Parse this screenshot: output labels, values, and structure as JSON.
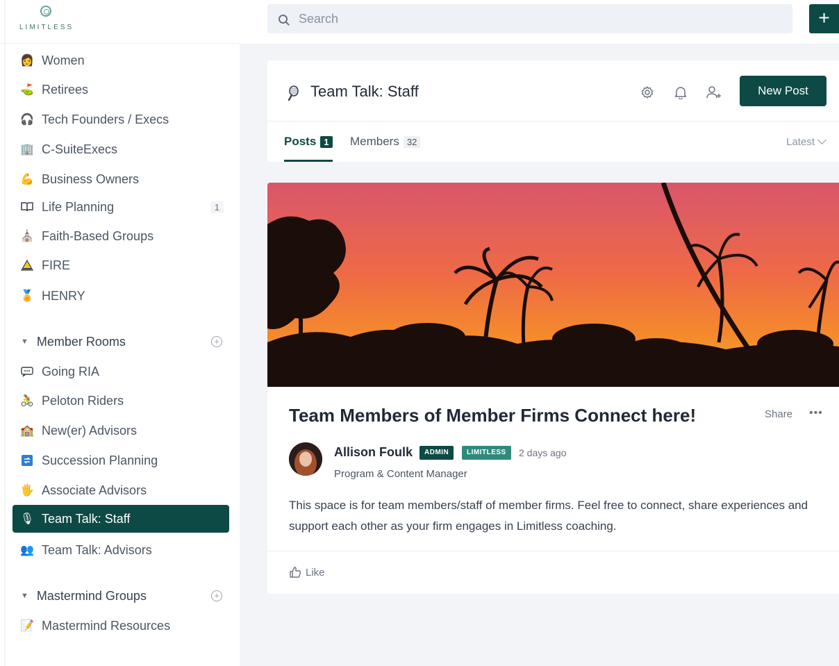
{
  "brand": {
    "name": "LIMITLESS",
    "accent": "#0d4a45"
  },
  "search": {
    "placeholder": "Search"
  },
  "topbar": {
    "add_label": "+"
  },
  "sidebar": {
    "items": [
      {
        "label": "Women",
        "icon": "woman-face-icon",
        "glyph": "👩"
      },
      {
        "label": "Retirees",
        "icon": "golf-icon",
        "glyph": "⛳"
      },
      {
        "label": "Tech Founders / Execs",
        "icon": "headphones-icon",
        "glyph": "🎧"
      },
      {
        "label": "C-SuiteExecs",
        "icon": "office-icon",
        "glyph": "🏢"
      },
      {
        "label": "Business Owners",
        "icon": "flexed-arm-icon",
        "glyph": "💪"
      },
      {
        "label": "Life Planning",
        "icon": "book-icon",
        "glyph": "📖",
        "count": "1"
      },
      {
        "label": "Faith-Based Groups",
        "icon": "church-icon",
        "glyph": "⛪"
      },
      {
        "label": "FIRE",
        "icon": "warning-triangle-icon",
        "glyph": "⚠"
      },
      {
        "label": "HENRY",
        "icon": "badge-icon",
        "glyph": "🏅"
      }
    ],
    "member_rooms": {
      "title": "Member Rooms",
      "items": [
        {
          "label": "Going RIA",
          "icon": "chat-bubble-icon",
          "glyph": "💬"
        },
        {
          "label": "Peloton Riders",
          "icon": "cyclist-icon",
          "glyph": "🚴"
        },
        {
          "label": "New(er) Advisors",
          "icon": "school-icon",
          "glyph": "🏫"
        },
        {
          "label": "Succession Planning",
          "icon": "arrows-cycle-icon",
          "glyph": "🔄"
        },
        {
          "label": "Associate Advisors",
          "icon": "hand-icon",
          "glyph": "🖐"
        },
        {
          "label": "Team Talk: Staff",
          "icon": "microphone-icon",
          "glyph": "🎙",
          "active": true
        },
        {
          "label": "Team Talk: Advisors",
          "icon": "people-icon",
          "glyph": "👥"
        }
      ]
    },
    "mastermind": {
      "title": "Mastermind Groups",
      "items": [
        {
          "label": "Mastermind Resources",
          "icon": "memo-icon",
          "glyph": "📝"
        }
      ]
    }
  },
  "space": {
    "title": "Team Talk: Staff",
    "new_post_label": "New Post",
    "tabs": [
      {
        "label": "Posts",
        "count": "1",
        "active": true
      },
      {
        "label": "Members",
        "count": "32"
      }
    ],
    "sort_label": "Latest"
  },
  "post": {
    "title": "Team Members of Member Firms Connect here!",
    "share_label": "Share",
    "more_label": "•••",
    "author": "Allison Foulk",
    "badges": [
      "ADMIN",
      "LIMITLESS"
    ],
    "time": "2 days ago",
    "role": "Program & Content Manager",
    "body": "This space is for team members/staff of member firms. Feel free to connect, share experiences and support each other as your firm engages in Limitless coaching.",
    "like_label": "Like"
  }
}
